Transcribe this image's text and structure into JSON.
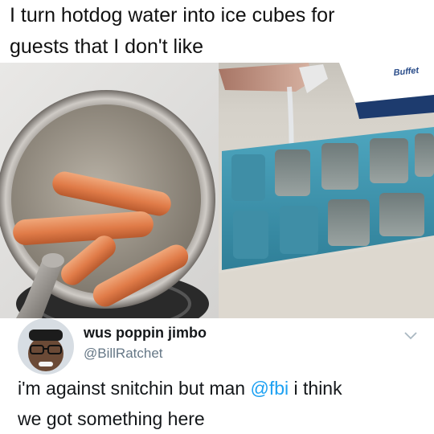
{
  "caption": {
    "line1": "I turn hotdog water into ice cubes for",
    "line2": "guests that I don't like"
  },
  "photos": {
    "tray_label": "Buffet"
  },
  "tweet": {
    "display_name": "wus poppin jimbo",
    "handle": "@BillRatchet",
    "text_part1": "i'm against snitchin but man ",
    "mention": "@fbi",
    "text_part2": " i think",
    "text_line2": "we got something here",
    "menu_icon": "chevron-down-icon",
    "colors": {
      "name": "#14171a",
      "handle": "#657786",
      "link": "#1da1f2"
    }
  }
}
